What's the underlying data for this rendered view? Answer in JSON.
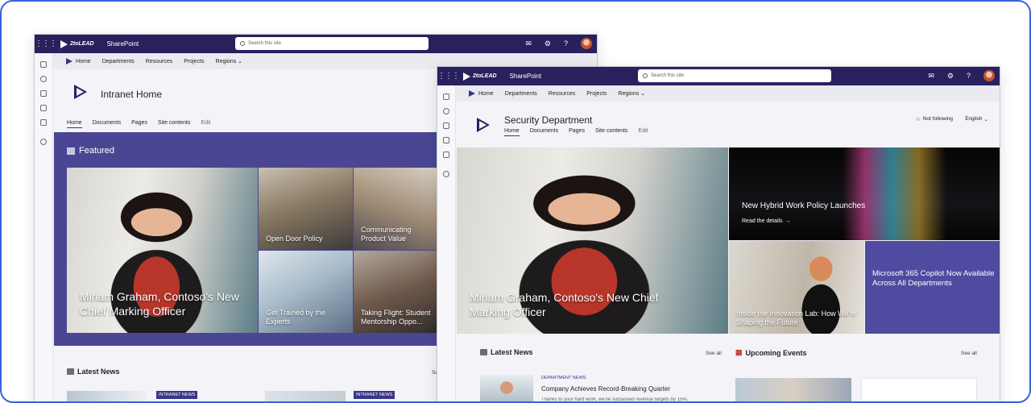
{
  "common": {
    "brand": "2toLEAD",
    "app_name": "SharePoint",
    "search_placeholder": "Search this site",
    "hub_nav": [
      "Home",
      "Departments",
      "Resources",
      "Projects",
      "Regions"
    ],
    "site_tabs": [
      "Home",
      "Documents",
      "Pages",
      "Site contents",
      "Edit"
    ]
  },
  "back_window": {
    "site_title": "Intranet Home",
    "featured_heading": "Featured",
    "tiles": [
      "Miriam Graham, Contoso's New Chief Marking Officer",
      "Open Door Policy",
      "Communicating Product Value",
      "Get Trained by the Experts",
      "Taking Flight: Student Mentorship Oppo..."
    ],
    "latest_news_heading": "Latest News",
    "news_tags": [
      "INTRANET NEWS",
      "INTRANET NEWS"
    ],
    "see_all_partial": "Se"
  },
  "front_window": {
    "site_title": "Security Department",
    "follow_label": "Not following",
    "language_label": "English",
    "hero_caption": "Miriam Graham, Contoso's New Chief Marking Officer",
    "tile_hybrid_title": "New Hybrid Work Policy Launches",
    "tile_hybrid_link": "Read the details",
    "tile_lab": "Inside the Innovation Lab: How We're Shaping the Future",
    "tile_copilot": "Microsoft 365 Copilot Now Available Across All Departments",
    "latest_news_heading": "Latest News",
    "latest_news_see_all": "See all",
    "news_item": {
      "category": "DEPARTMENT NEWS",
      "title": "Company Achieves Record-Breaking Quarter",
      "snippet": "Thanks to your hard work, we've surpassed revenue targets by 15%."
    },
    "events_heading": "Upcoming Events",
    "events_see_all": "See all"
  }
}
